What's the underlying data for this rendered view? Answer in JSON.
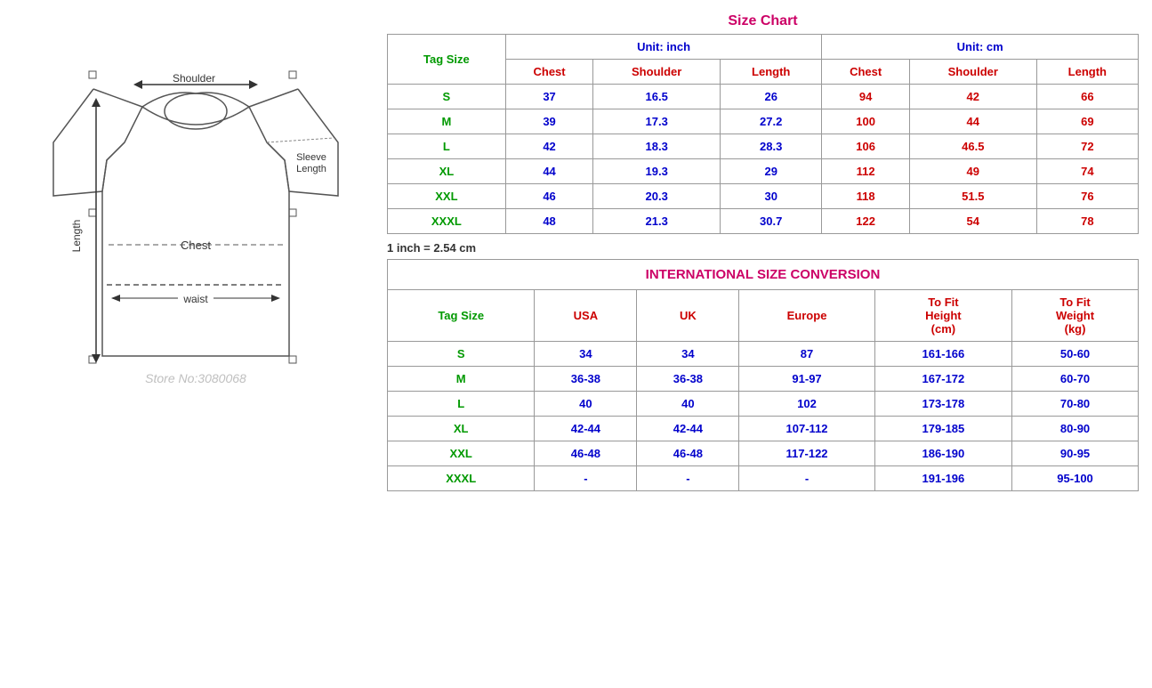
{
  "sizeChart": {
    "title": "Size Chart",
    "unitInch": "Unit: inch",
    "unitCm": "Unit: cm",
    "tagSizeLabel": "Tag Size",
    "inchColumns": [
      "Chest",
      "Shoulder",
      "Length"
    ],
    "cmColumns": [
      "Chest",
      "Shoulder",
      "Length"
    ],
    "note": "1 inch = 2.54 cm",
    "rows": [
      {
        "tag": "S",
        "chest_in": "37",
        "shoulder_in": "16.5",
        "length_in": "26",
        "chest_cm": "94",
        "shoulder_cm": "42",
        "length_cm": "66"
      },
      {
        "tag": "M",
        "chest_in": "39",
        "shoulder_in": "17.3",
        "length_in": "27.2",
        "chest_cm": "100",
        "shoulder_cm": "44",
        "length_cm": "69"
      },
      {
        "tag": "L",
        "chest_in": "42",
        "shoulder_in": "18.3",
        "length_in": "28.3",
        "chest_cm": "106",
        "shoulder_cm": "46.5",
        "length_cm": "72"
      },
      {
        "tag": "XL",
        "chest_in": "44",
        "shoulder_in": "19.3",
        "length_in": "29",
        "chest_cm": "112",
        "shoulder_cm": "49",
        "length_cm": "74"
      },
      {
        "tag": "XXL",
        "chest_in": "46",
        "shoulder_in": "20.3",
        "length_in": "30",
        "chest_cm": "118",
        "shoulder_cm": "51.5",
        "length_cm": "76"
      },
      {
        "tag": "XXXL",
        "chest_in": "48",
        "shoulder_in": "21.3",
        "length_in": "30.7",
        "chest_cm": "122",
        "shoulder_cm": "54",
        "length_cm": "78"
      }
    ]
  },
  "conversion": {
    "title": "INTERNATIONAL SIZE CONVERSION",
    "tagSizeLabel": "Tag Size",
    "columns": [
      "USA",
      "UK",
      "Europe",
      "To Fit Height (cm)",
      "To Fit Weight (kg)"
    ],
    "rows": [
      {
        "tag": "S",
        "usa": "34",
        "uk": "34",
        "europe": "87",
        "height": "161-166",
        "weight": "50-60"
      },
      {
        "tag": "M",
        "usa": "36-38",
        "uk": "36-38",
        "europe": "91-97",
        "height": "167-172",
        "weight": "60-70"
      },
      {
        "tag": "L",
        "usa": "40",
        "uk": "40",
        "europe": "102",
        "height": "173-178",
        "weight": "70-80"
      },
      {
        "tag": "XL",
        "usa": "42-44",
        "uk": "42-44",
        "europe": "107-112",
        "height": "179-185",
        "weight": "80-90"
      },
      {
        "tag": "XXL",
        "usa": "46-48",
        "uk": "46-48",
        "europe": "117-122",
        "height": "186-190",
        "weight": "90-95"
      },
      {
        "tag": "XXXL",
        "usa": "-",
        "uk": "-",
        "europe": "-",
        "height": "191-196",
        "weight": "95-100"
      }
    ]
  }
}
